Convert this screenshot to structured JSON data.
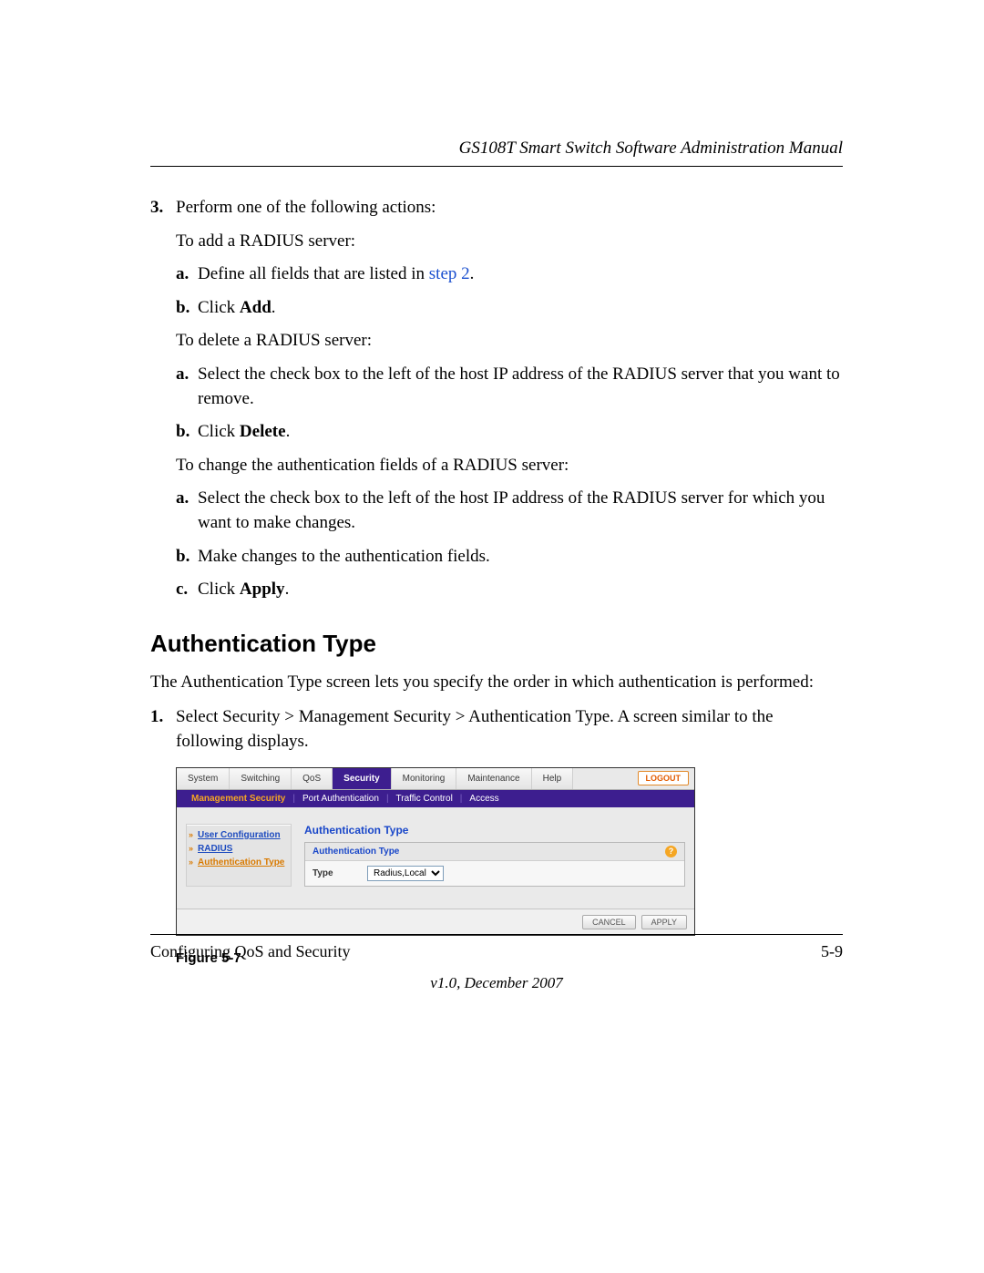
{
  "header": {
    "title": "GS108T Smart Switch Software Administration Manual"
  },
  "step3": {
    "num": "3.",
    "lead": "Perform one of the following actions:",
    "add_lead": "To add a RADIUS server:",
    "a1_letter": "a.",
    "a1_text_pre": "Define all fields that are listed in ",
    "a1_link": "step 2",
    "a1_text_post": ".",
    "b1_letter": "b.",
    "b1_pre": "Click ",
    "b1_bold": "Add",
    "b1_post": ".",
    "del_lead": "To delete a RADIUS server:",
    "a2_letter": "a.",
    "a2_text": "Select the check box to the left of the host IP address of the RADIUS server that you want to remove.",
    "b2_letter": "b.",
    "b2_pre": "Click ",
    "b2_bold": "Delete",
    "b2_post": ".",
    "chg_lead": "To change the authentication fields of a RADIUS server:",
    "a3_letter": "a.",
    "a3_text": "Select the check box to the left of the host IP address of the RADIUS server for which you want to make changes.",
    "b3_letter": "b.",
    "b3_text": "Make changes to the authentication fields.",
    "c3_letter": "c.",
    "c3_pre": "Click ",
    "c3_bold": "Apply",
    "c3_post": "."
  },
  "section": {
    "title": "Authentication Type",
    "intro": "The Authentication Type screen lets you specify the order in which authentication is performed:",
    "step1_num": "1.",
    "step1_text": "Select Security > Management Security > Authentication Type. A screen similar to the following displays."
  },
  "figure": {
    "tabs": [
      "System",
      "Switching",
      "QoS",
      "Security",
      "Monitoring",
      "Maintenance",
      "Help"
    ],
    "active_tab_index": 3,
    "logout": "LOGOUT",
    "subnav": [
      "Management Security",
      "Port Authentication",
      "Traffic Control",
      "Access"
    ],
    "subnav_active_index": 0,
    "sidemenu": [
      "User Configuration",
      "RADIUS",
      "Authentication Type"
    ],
    "sidemenu_active_index": 2,
    "panel_title": "Authentication Type",
    "box_title": "Authentication Type",
    "row_label": "Type",
    "row_value": "Radius,Local",
    "help": "?",
    "cancel": "CANCEL",
    "apply": "APPLY",
    "caption": "Figure 5-7"
  },
  "footer": {
    "left": "Configuring QoS and Security",
    "right": "5-9",
    "version": "v1.0, December 2007"
  }
}
